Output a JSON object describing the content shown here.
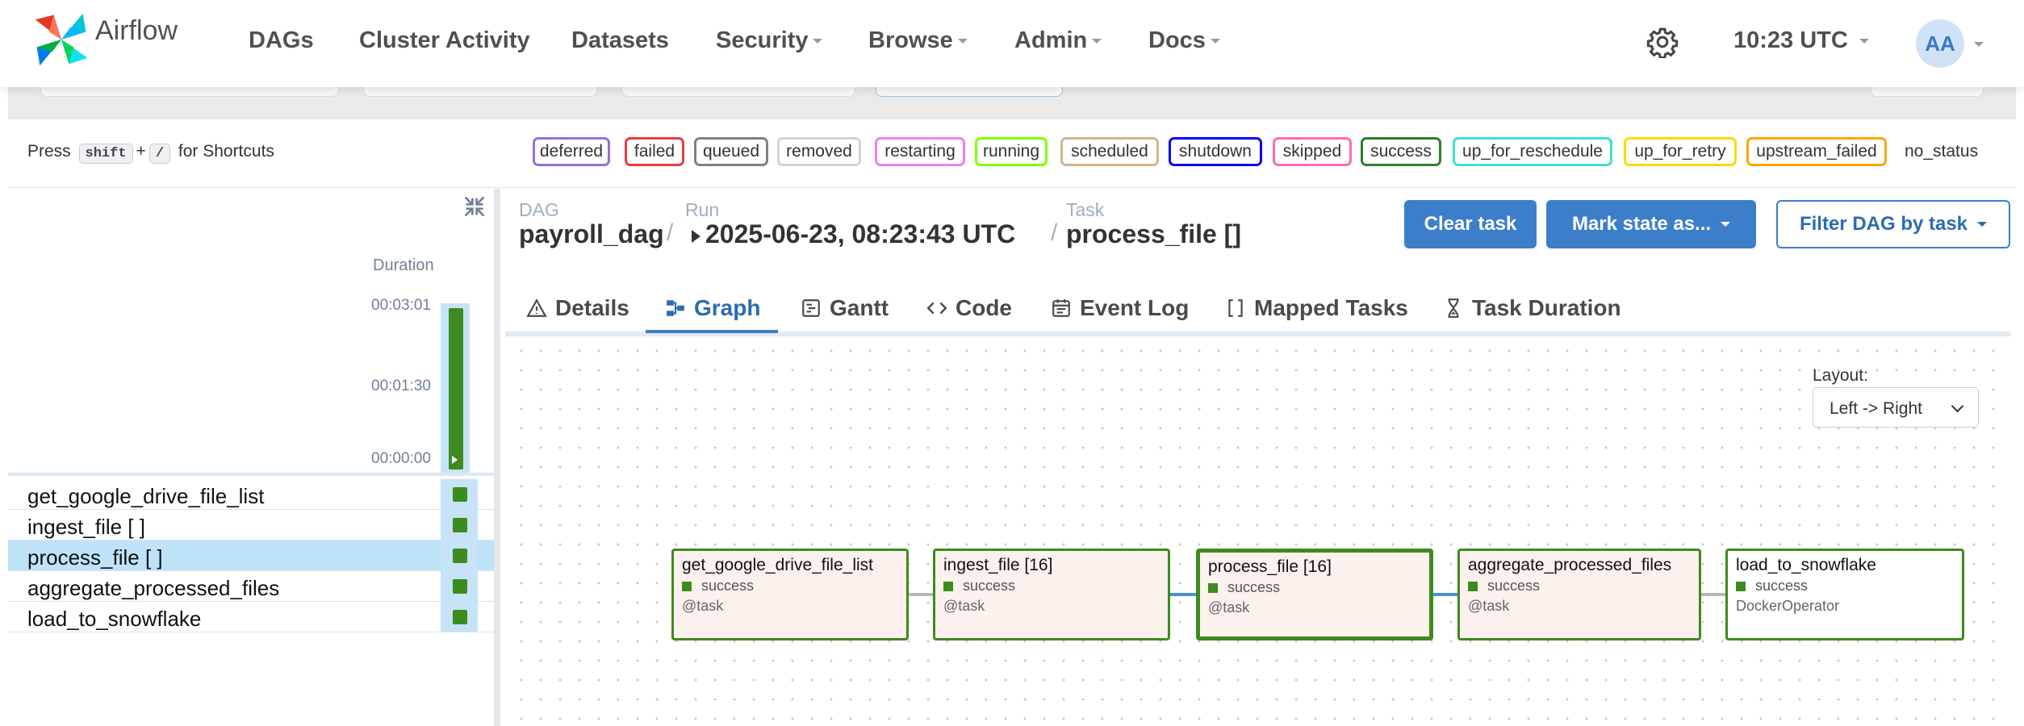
{
  "nav": {
    "brand": "Airflow",
    "items": [
      "DAGs",
      "Cluster Activity",
      "Datasets",
      "Security",
      "Browse",
      "Admin",
      "Docs"
    ],
    "clock": "10:23 UTC",
    "avatar": "AA"
  },
  "shortcuts": {
    "prefix": "Press",
    "key1": "shift",
    "plus": "+",
    "key2": "/",
    "suffix": "for Shortcuts"
  },
  "legend": {
    "chips": [
      {
        "label": "deferred",
        "color": "#9370db"
      },
      {
        "label": "failed",
        "color": "#e53e3e"
      },
      {
        "label": "queued",
        "color": "#808080"
      },
      {
        "label": "removed",
        "color": "#d3d3d3"
      },
      {
        "label": "restarting",
        "color": "#ee82ee"
      },
      {
        "label": "running",
        "color": "#7fff00"
      },
      {
        "label": "scheduled",
        "color": "#d2b48c"
      },
      {
        "label": "shutdown",
        "color": "#0000ff"
      },
      {
        "label": "skipped",
        "color": "#ff69b4"
      },
      {
        "label": "success",
        "color": "#2e7d32"
      },
      {
        "label": "up_for_reschedule",
        "color": "#40e0d0"
      },
      {
        "label": "up_for_retry",
        "color": "#ffd700"
      },
      {
        "label": "upstream_failed",
        "color": "#ffa500"
      }
    ],
    "no_status": "no_status"
  },
  "grid": {
    "duration_title": "Duration",
    "ticks": [
      "00:03:01",
      "00:01:30",
      "00:00:00"
    ],
    "run_duration_fraction": 1.0,
    "tasks": [
      {
        "label": "get_google_drive_file_list",
        "state": "success"
      },
      {
        "label": "ingest_file [ ]",
        "state": "success"
      },
      {
        "label": "process_file [ ]",
        "state": "success"
      },
      {
        "label": "aggregate_processed_files",
        "state": "success"
      },
      {
        "label": "load_to_snowflake",
        "state": "success"
      }
    ]
  },
  "breadcrumb": {
    "dag_label": "DAG",
    "dag_value": "payroll_dag",
    "run_label": "Run",
    "run_value": "2025-06-23, 08:23:43 UTC",
    "task_label": "Task",
    "task_value": "process_file []",
    "separator": "/"
  },
  "actions": {
    "clear": "Clear task",
    "mark_state": "Mark state as...",
    "filter": "Filter DAG by task"
  },
  "tabs": [
    {
      "label": "Details",
      "icon": "warning-triangle-icon"
    },
    {
      "label": "Graph",
      "icon": "graph-icon"
    },
    {
      "label": "Gantt",
      "icon": "gantt-icon"
    },
    {
      "label": "Code",
      "icon": "code-icon"
    },
    {
      "label": "Event Log",
      "icon": "calendar-log-icon"
    },
    {
      "label": "Mapped Tasks",
      "icon": "brackets-icon"
    },
    {
      "label": "Task Duration",
      "icon": "hourglass-icon"
    }
  ],
  "active_tab": "Graph",
  "graph": {
    "layout_label": "Layout:",
    "layout_value": "Left -> Right",
    "nodes": [
      {
        "name": "get_google_drive_file_list",
        "state": "success",
        "operator": "@task"
      },
      {
        "name": "ingest_file [16]",
        "state": "success",
        "operator": "@task"
      },
      {
        "name": "process_file [16]",
        "state": "success",
        "operator": "@task"
      },
      {
        "name": "aggregate_processed_files",
        "state": "success",
        "operator": "@task"
      },
      {
        "name": "load_to_snowflake",
        "state": "success",
        "operator": "DockerOperator"
      }
    ]
  },
  "colors": {
    "success": "#3d8b1e",
    "accent": "#3d7ecb",
    "selected_row": "#bee3f8"
  }
}
